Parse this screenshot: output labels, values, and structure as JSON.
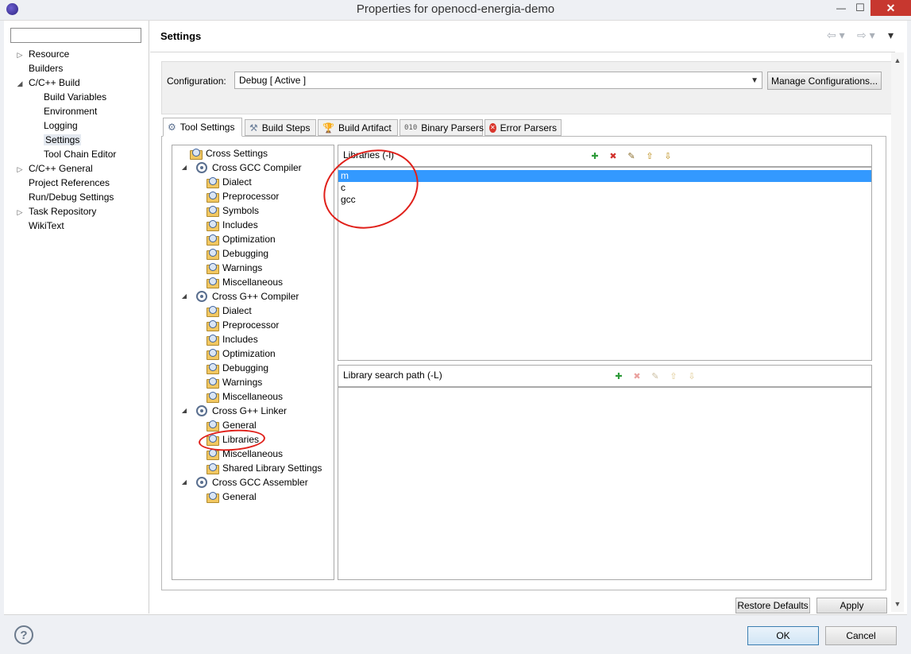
{
  "window": {
    "title": "Properties for openocd-energia-demo",
    "minimize_glyph": "—",
    "maximize_glyph": "☐",
    "close_glyph": "✕"
  },
  "filter": {
    "value": "",
    "placeholder": ""
  },
  "nav": {
    "items": [
      {
        "label": "Resource",
        "expander": "▷",
        "indent": 0
      },
      {
        "label": "Builders",
        "expander": "",
        "indent": 0
      },
      {
        "label": "C/C++ Build",
        "expander": "◢",
        "indent": 0
      },
      {
        "label": "Build Variables",
        "expander": "",
        "indent": 1
      },
      {
        "label": "Environment",
        "expander": "",
        "indent": 1
      },
      {
        "label": "Logging",
        "expander": "",
        "indent": 1
      },
      {
        "label": "Settings",
        "expander": "",
        "indent": 1,
        "selected": true
      },
      {
        "label": "Tool Chain Editor",
        "expander": "",
        "indent": 1
      },
      {
        "label": "C/C++ General",
        "expander": "▷",
        "indent": 0
      },
      {
        "label": "Project References",
        "expander": "",
        "indent": 0
      },
      {
        "label": "Run/Debug Settings",
        "expander": "",
        "indent": 0
      },
      {
        "label": "Task Repository",
        "expander": "▷",
        "indent": 0
      },
      {
        "label": "WikiText",
        "expander": "",
        "indent": 0
      }
    ]
  },
  "header": {
    "title": "Settings",
    "back_glyph": "⇦ ▾",
    "forward_glyph": "⇨ ▾",
    "menu_glyph": "▾"
  },
  "configuration": {
    "label": "Configuration:",
    "selected": "Debug  [ Active ]",
    "manage_label": "Manage Configurations..."
  },
  "tabs": [
    {
      "label": "Tool Settings",
      "icon": "tool-settings-icon",
      "active": true
    },
    {
      "label": "Build Steps",
      "icon": "build-steps-icon"
    },
    {
      "label": "Build Artifact",
      "icon": "trophy-icon"
    },
    {
      "label": "Binary Parsers",
      "icon": "binary-icon"
    },
    {
      "label": "Error Parsers",
      "icon": "error-icon"
    }
  ],
  "tool_tree": [
    {
      "label": "Cross Settings",
      "kind": "leaf",
      "level": 0
    },
    {
      "label": "Cross GCC Compiler",
      "kind": "tool",
      "level": 0
    },
    {
      "label": "Dialect",
      "kind": "leaf",
      "level": 1
    },
    {
      "label": "Preprocessor",
      "kind": "leaf",
      "level": 1
    },
    {
      "label": "Symbols",
      "kind": "leaf",
      "level": 1
    },
    {
      "label": "Includes",
      "kind": "leaf",
      "level": 1
    },
    {
      "label": "Optimization",
      "kind": "leaf",
      "level": 1
    },
    {
      "label": "Debugging",
      "kind": "leaf",
      "level": 1
    },
    {
      "label": "Warnings",
      "kind": "leaf",
      "level": 1
    },
    {
      "label": "Miscellaneous",
      "kind": "leaf",
      "level": 1
    },
    {
      "label": "Cross G++ Compiler",
      "kind": "tool",
      "level": 0
    },
    {
      "label": "Dialect",
      "kind": "leaf",
      "level": 1
    },
    {
      "label": "Preprocessor",
      "kind": "leaf",
      "level": 1
    },
    {
      "label": "Includes",
      "kind": "leaf",
      "level": 1
    },
    {
      "label": "Optimization",
      "kind": "leaf",
      "level": 1
    },
    {
      "label": "Debugging",
      "kind": "leaf",
      "level": 1
    },
    {
      "label": "Warnings",
      "kind": "leaf",
      "level": 1
    },
    {
      "label": "Miscellaneous",
      "kind": "leaf",
      "level": 1
    },
    {
      "label": "Cross G++ Linker",
      "kind": "tool",
      "level": 0
    },
    {
      "label": "General",
      "kind": "leaf",
      "level": 1
    },
    {
      "label": "Libraries",
      "kind": "leaf",
      "level": 1,
      "selected": true
    },
    {
      "label": "Miscellaneous",
      "kind": "leaf",
      "level": 1
    },
    {
      "label": "Shared Library Settings",
      "kind": "leaf",
      "level": 1
    },
    {
      "label": "Cross GCC Assembler",
      "kind": "tool",
      "level": 0
    },
    {
      "label": "General",
      "kind": "leaf",
      "level": 1
    }
  ],
  "libraries": {
    "label": "Libraries (-l)",
    "items": [
      "m",
      "c",
      "gcc"
    ],
    "selected_index": 0
  },
  "library_paths": {
    "label": "Library search path (-L)",
    "items": []
  },
  "list_tools": [
    {
      "name": "add-icon",
      "glyph": "✚",
      "color": "#2e9b3a"
    },
    {
      "name": "delete-icon",
      "glyph": "✖",
      "color": "#d2322d"
    },
    {
      "name": "edit-icon",
      "glyph": "✎",
      "color": "#8a6d2b"
    },
    {
      "name": "move-up-icon",
      "glyph": "⇧",
      "color": "#b8860b"
    },
    {
      "name": "move-down-icon",
      "glyph": "⇩",
      "color": "#b8860b"
    }
  ],
  "buttons": {
    "restore_defaults": "Restore Defaults",
    "apply": "Apply",
    "ok": "OK",
    "cancel": "Cancel",
    "help": "?"
  },
  "colors": {
    "selection": "#3399ff",
    "annotation": "#e0201a"
  }
}
